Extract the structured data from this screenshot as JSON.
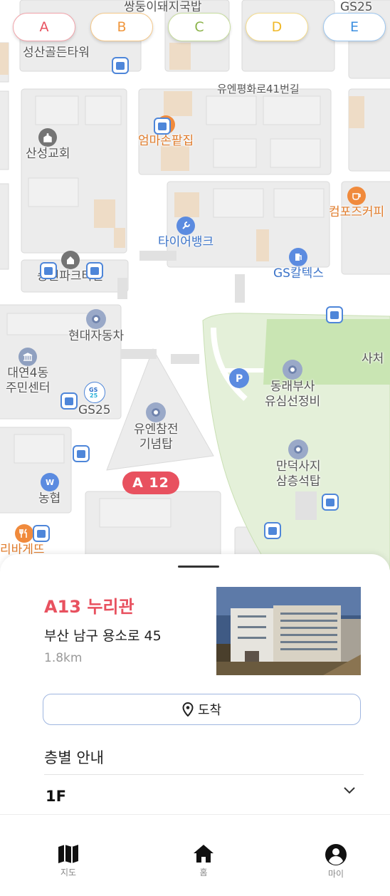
{
  "categories": [
    {
      "label": "A",
      "color": "#e8515f",
      "border": "#f2a4ab"
    },
    {
      "label": "B",
      "color": "#f0963c",
      "border": "#f5c889"
    },
    {
      "label": "C",
      "color": "#8bb34a",
      "border": "#c7dd9e"
    },
    {
      "label": "D",
      "color": "#f0b828",
      "border": "#f5dc8a"
    },
    {
      "label": "E",
      "color": "#3c8fe0",
      "border": "#9cc6ef"
    }
  ],
  "map": {
    "labels": {
      "ssangdung": "쌍둥이돼지국밥",
      "gs25_top": "GS25",
      "seongsan": "성산골든타워",
      "unpyeong_road": "유엔평화로41번길",
      "eommason": "엄마손팥집",
      "sanseong_church": "산성교회",
      "compose": "컴포즈커피",
      "tirebank": "타이어뱅크",
      "songwon": "송원파크타운",
      "gs_caltex": "GS칼텍스",
      "hyundai": "현대자동차",
      "daeyeon_line1": "대연4동",
      "daeyeon_line2": "주민센터",
      "gs25": "GS25",
      "un_mem_line1": "유엔참전",
      "un_mem_line2": "기념탑",
      "dongrae_line1": "동래부사",
      "dongrae_line2": "유심선정비",
      "mandeok_line1": "만덕사지",
      "mandeok_line2": "삼층석탑",
      "nonghyup": "농협",
      "bakery": "리바게뜨",
      "sacheol": "사처"
    },
    "marker_a12": "A 12"
  },
  "place": {
    "title": "A13 누리관",
    "address": "부산 남구 용소로 45",
    "distance": "1.8km",
    "arrive_label": "도착"
  },
  "floor_guide": {
    "title": "층별 안내",
    "current_floor": "1F"
  },
  "tabs": [
    {
      "label": "지도",
      "icon": "map-icon"
    },
    {
      "label": "홈",
      "icon": "home-icon"
    },
    {
      "label": "마이",
      "icon": "account-icon"
    }
  ]
}
